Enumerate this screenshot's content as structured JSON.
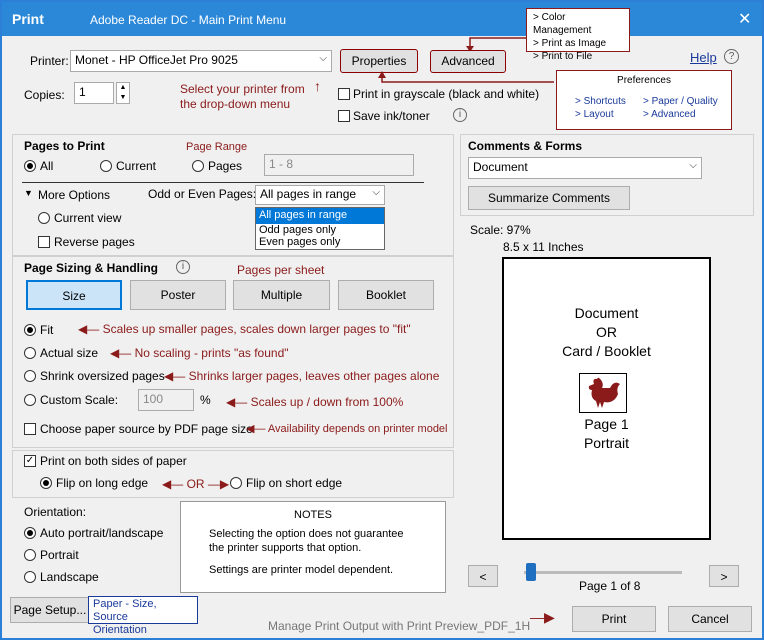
{
  "window": {
    "title": "Print",
    "subtitle": "Adobe Reader DC - Main Print Menu"
  },
  "callouts": {
    "advanced_menu": [
      "> Color Management",
      "> Print as Image",
      "> Print to File"
    ],
    "preferences": {
      "title": "Preferences",
      "col1": [
        "> Shortcuts",
        "> Layout"
      ],
      "col2": [
        "> Paper / Quality",
        "> Advanced"
      ]
    },
    "paper_source": [
      "Paper - Size, Source",
      "Orientation"
    ],
    "notes": {
      "title": "NOTES",
      "line1": "Selecting the option does not guarantee",
      "line2": "the printer supports that option.",
      "line3": "Settings are printer model dependent."
    }
  },
  "printer": {
    "label": "Printer:",
    "value": "Monet - HP OfficeJet Pro 9025",
    "properties": "Properties",
    "advanced": "Advanced",
    "help": "Help",
    "copies_label": "Copies:",
    "copies_value": "1",
    "grayscale": "Print in grayscale (black and white)",
    "save_ink": "Save ink/toner"
  },
  "annotations": {
    "select_printer_1": "Select your printer from",
    "select_printer_2": "the drop-down menu",
    "page_range": "Page Range",
    "pages_per_sheet": "Pages per sheet",
    "fit": "Scales up smaller pages, scales down larger pages to \"fit\"",
    "actual": "No scaling - prints \"as found\"",
    "shrink": "Shrinks larger pages, leaves other pages alone",
    "custom": "Scales up / down from 100%",
    "paper_source": "Availability depends on printer model",
    "or": "OR",
    "manage": "Manage Print Output with Print Preview_PDF_1H"
  },
  "pages_to_print": {
    "title": "Pages to Print",
    "all": "All",
    "current": "Current",
    "pages": "Pages",
    "pages_value": "1 - 8",
    "more_options": "More Options",
    "current_view": "Current view",
    "reverse": "Reverse pages",
    "odd_even_label": "Odd or Even Pages:",
    "odd_even_value": "All pages in range",
    "odd_even_options": [
      "All pages in range",
      "Odd pages only",
      "Even pages only"
    ]
  },
  "sizing": {
    "title": "Page Sizing & Handling",
    "buttons": [
      "Size",
      "Poster",
      "Multiple",
      "Booklet"
    ],
    "fit": "Fit",
    "actual": "Actual size",
    "shrink": "Shrink oversized pages",
    "custom": "Custom Scale:",
    "custom_value": "100",
    "percent": "%",
    "paper_source": "Choose paper source by PDF page size"
  },
  "duplex": {
    "both_sides": "Print on both sides of paper",
    "long_edge": "Flip on long edge",
    "short_edge": "Flip on short edge"
  },
  "orientation": {
    "title": "Orientation:",
    "auto": "Auto portrait/landscape",
    "portrait": "Portrait",
    "landscape": "Landscape"
  },
  "comments": {
    "title": "Comments & Forms",
    "value": "Document",
    "summarize": "Summarize Comments"
  },
  "preview": {
    "scale": "Scale:  97%",
    "paper": "8.5 x 11 Inches",
    "line1": "Document",
    "line2": "OR",
    "line3": "Card / Booklet",
    "line4": "Page 1",
    "line5": "Portrait",
    "prev": "<",
    "next": ">",
    "page_info": "Page 1 of 8",
    "slider_fraction": 0.0
  },
  "footer": {
    "page_setup": "Page Setup...",
    "print": "Print",
    "cancel": "Cancel"
  }
}
